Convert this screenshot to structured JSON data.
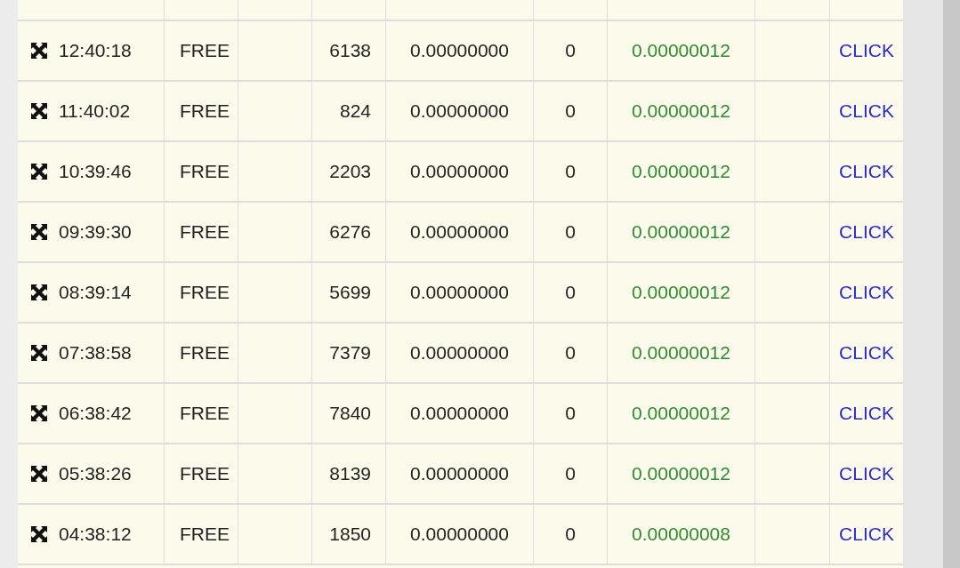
{
  "rows": [
    {
      "time": "12:40:18",
      "type": "FREE",
      "number": "6138",
      "amount": "0.00000000",
      "count": "0",
      "reward": "0.00000012",
      "action": "CLICK"
    },
    {
      "time": "11:40:02",
      "type": "FREE",
      "number": "824",
      "amount": "0.00000000",
      "count": "0",
      "reward": "0.00000012",
      "action": "CLICK"
    },
    {
      "time": "10:39:46",
      "type": "FREE",
      "number": "2203",
      "amount": "0.00000000",
      "count": "0",
      "reward": "0.00000012",
      "action": "CLICK"
    },
    {
      "time": "09:39:30",
      "type": "FREE",
      "number": "6276",
      "amount": "0.00000000",
      "count": "0",
      "reward": "0.00000012",
      "action": "CLICK"
    },
    {
      "time": "08:39:14",
      "type": "FREE",
      "number": "5699",
      "amount": "0.00000000",
      "count": "0",
      "reward": "0.00000012",
      "action": "CLICK"
    },
    {
      "time": "07:38:58",
      "type": "FREE",
      "number": "7379",
      "amount": "0.00000000",
      "count": "0",
      "reward": "0.00000012",
      "action": "CLICK"
    },
    {
      "time": "06:38:42",
      "type": "FREE",
      "number": "7840",
      "amount": "0.00000000",
      "count": "0",
      "reward": "0.00000012",
      "action": "CLICK"
    },
    {
      "time": "05:38:26",
      "type": "FREE",
      "number": "8139",
      "amount": "0.00000000",
      "count": "0",
      "reward": "0.00000012",
      "action": "CLICK"
    },
    {
      "time": "04:38:12",
      "type": "FREE",
      "number": "1850",
      "amount": "0.00000000",
      "count": "0",
      "reward": "0.00000008",
      "action": "CLICK"
    }
  ]
}
